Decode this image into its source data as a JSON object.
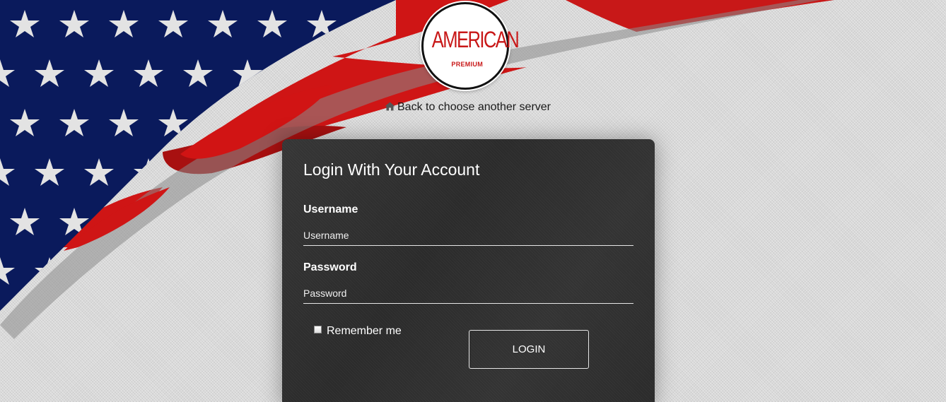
{
  "logo": {
    "word": "AMERICAN",
    "sub": "PREMIUM"
  },
  "nav": {
    "back_icon": "home-icon",
    "back_label": "Back to choose another server"
  },
  "login": {
    "title": "Login With Your Account",
    "username_label": "Username",
    "username_placeholder": "Username",
    "username_value": "",
    "password_label": "Password",
    "password_placeholder": "Password",
    "password_value": "",
    "remember_label": "Remember me",
    "remember_checked": false,
    "submit_label": "LOGIN"
  },
  "colors": {
    "flag_blue": "#0a1a5c",
    "flag_red": "#d11414",
    "flag_white": "#e2e2e2",
    "panel_bg": "#2b2b2b",
    "logo_red": "#c81818"
  }
}
